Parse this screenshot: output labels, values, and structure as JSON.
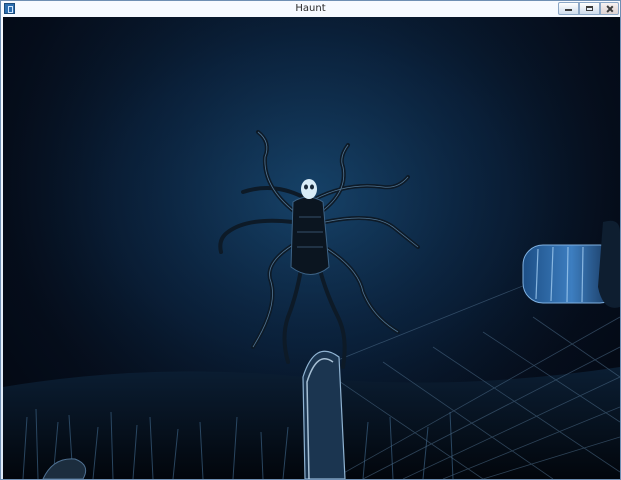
{
  "window": {
    "title": "Haunt",
    "icon": "game-app-icon",
    "controls": [
      "minimize-icon",
      "maximize-icon",
      "close-icon"
    ]
  },
  "scene": {
    "description_colors": {
      "sky": "#0a1f38",
      "glow": "#1e5a8a",
      "creature": "#0b1520",
      "highlight": "#9fc6e6"
    }
  }
}
